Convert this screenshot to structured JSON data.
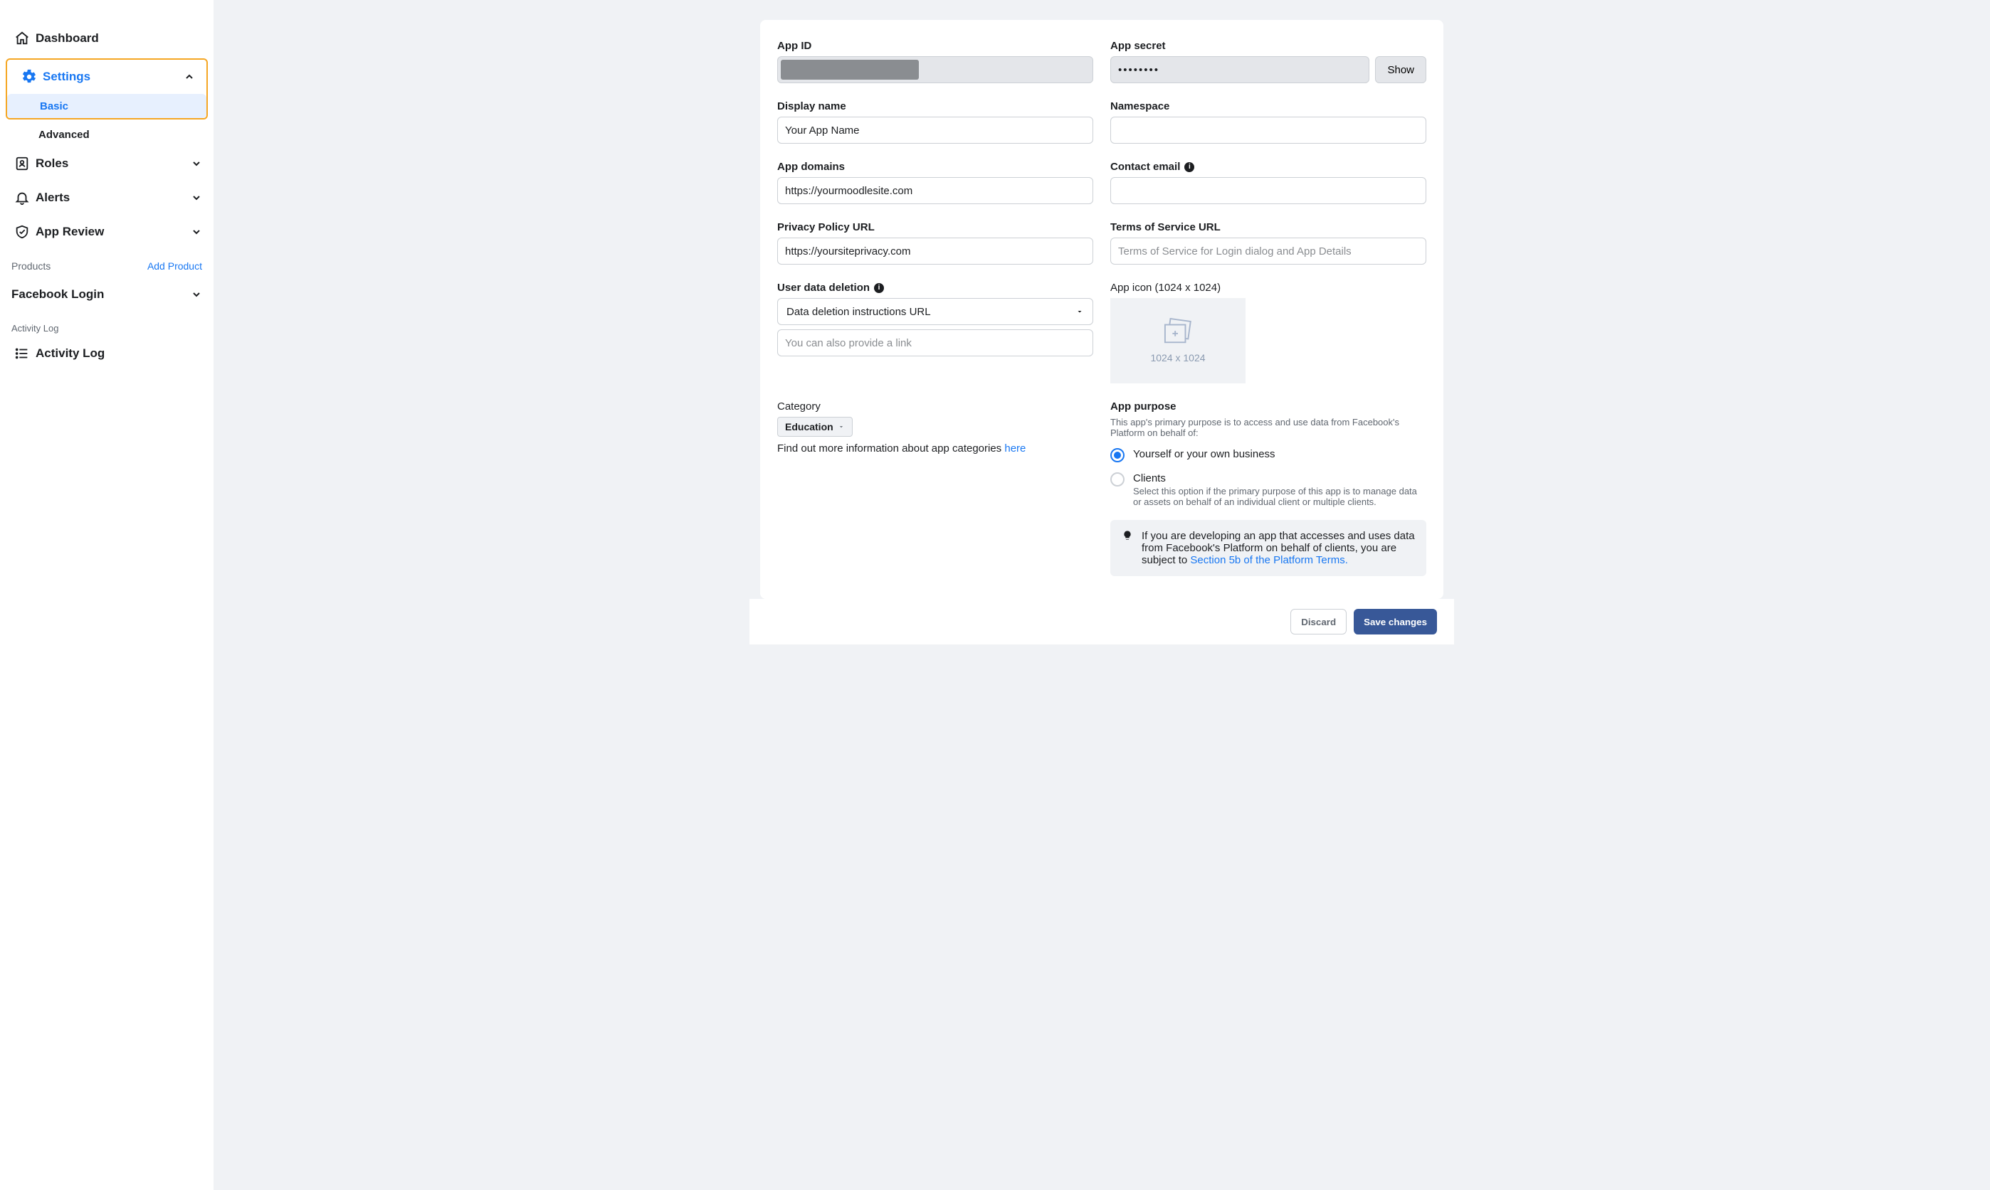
{
  "sidebar": {
    "dashboard": "Dashboard",
    "settings": "Settings",
    "settings_sub": {
      "basic": "Basic",
      "advanced": "Advanced"
    },
    "roles": "Roles",
    "alerts": "Alerts",
    "app_review": "App Review",
    "products_label": "Products",
    "add_product": "Add Product",
    "facebook_login": "Facebook Login",
    "activity_log_label": "Activity Log",
    "activity_log": "Activity Log"
  },
  "form": {
    "app_id_label": "App ID",
    "app_secret_label": "App secret",
    "app_secret_masked": "••••••••",
    "show_btn": "Show",
    "display_name_label": "Display name",
    "display_name_value": "Your App Name",
    "namespace_label": "Namespace",
    "namespace_value": "",
    "app_domains_label": "App domains",
    "app_domains_value": "https://yourmoodlesite.com",
    "contact_email_label": "Contact email",
    "contact_email_value": "",
    "privacy_label": "Privacy Policy URL",
    "privacy_value": "https://yoursiteprivacy.com",
    "tos_label": "Terms of Service URL",
    "tos_placeholder": "Terms of Service for Login dialog and App Details",
    "udd_label": "User data deletion",
    "udd_select": "Data deletion instructions URL",
    "udd_placeholder": "You can also provide a link",
    "app_icon_label": "App icon (1024 x 1024)",
    "app_icon_hint": "1024 x 1024",
    "category_label": "Category",
    "category_value": "Education",
    "category_help_pre": "Find out more information about app categories ",
    "category_help_link": "here",
    "purpose_label": "App purpose",
    "purpose_desc": "This app's primary purpose is to access and use data from Facebook's Platform on behalf of:",
    "purpose_opt1": "Yourself or your own business",
    "purpose_opt2": "Clients",
    "purpose_opt2_sub": "Select this option if the primary purpose of this app is to manage data or assets on behalf of an individual client or multiple clients.",
    "tip_text": "If you are developing an app that accesses and uses data from Facebook's Platform on behalf of clients, you are subject to ",
    "tip_link": "Section 5b of the Platform Terms."
  },
  "footer": {
    "discard": "Discard",
    "save": "Save changes"
  }
}
